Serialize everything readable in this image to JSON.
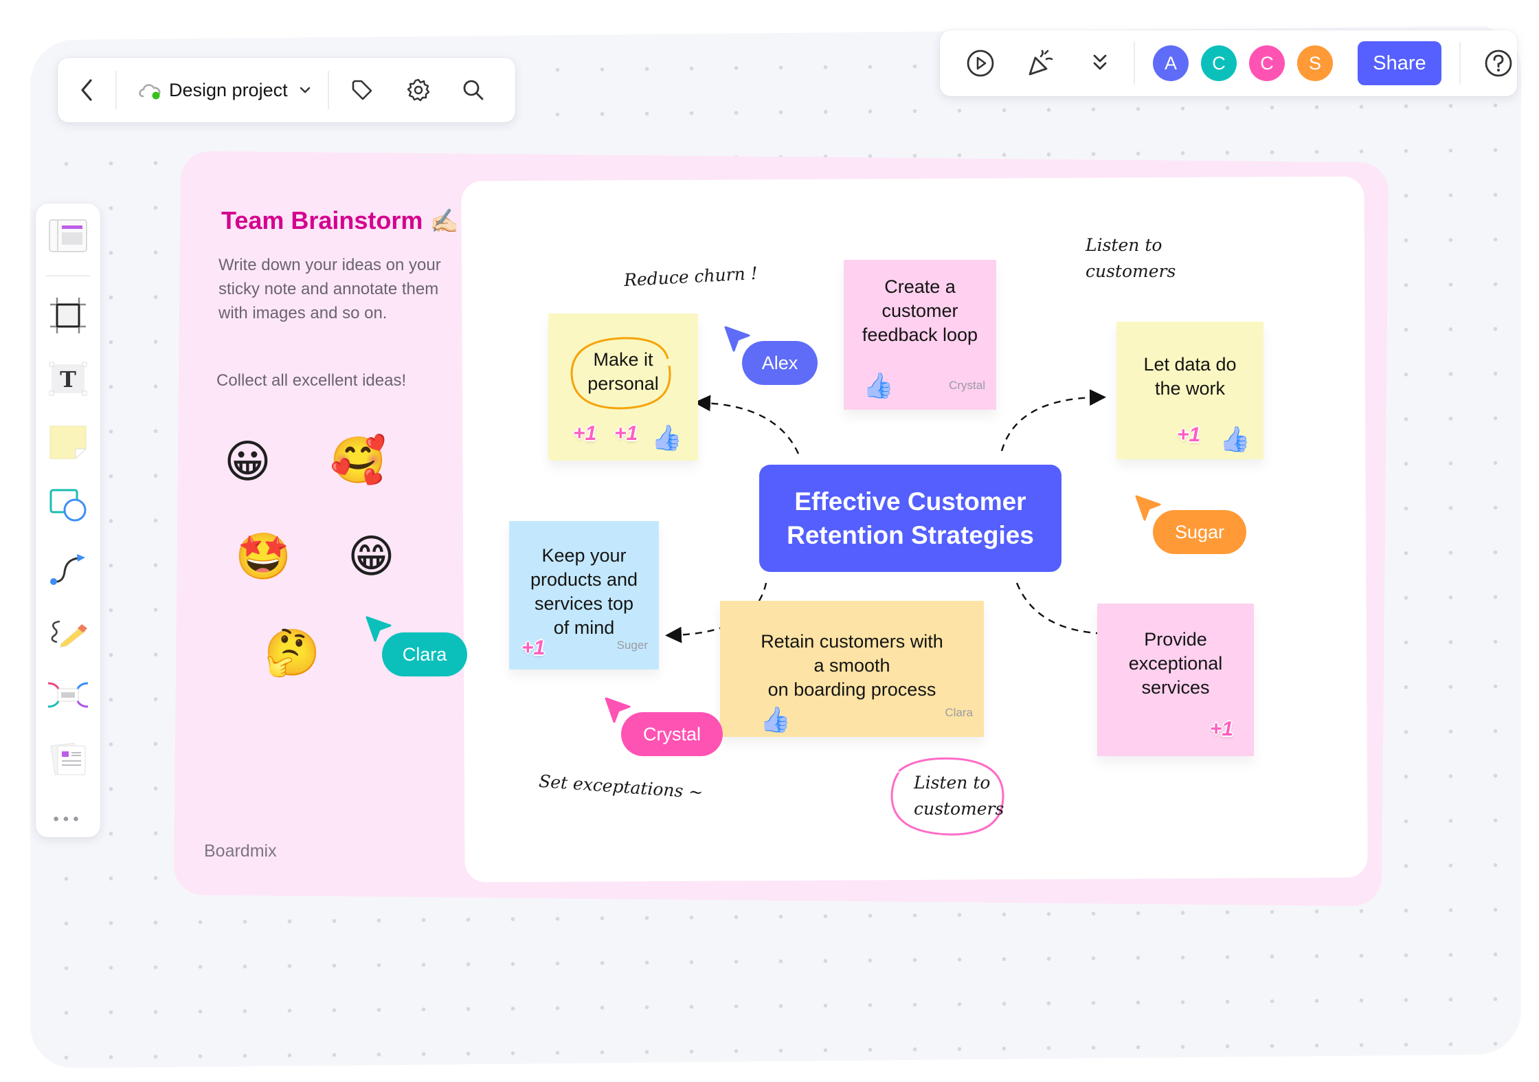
{
  "toolbar_left": {
    "back_label": "Back",
    "doc_title": "Design project",
    "sync_status": "synced",
    "icons": [
      "chevron-left-icon",
      "cloud-icon",
      "chevron-down-icon",
      "tag-icon",
      "gear-icon",
      "search-icon"
    ]
  },
  "toolbar_right": {
    "icons": [
      "play-icon",
      "celebrate-icon",
      "double-chevron-down-icon",
      "help-icon"
    ],
    "avatars": [
      {
        "initial": "A",
        "color": "#5e6cf8"
      },
      {
        "initial": "C",
        "color": "#0bc0bb"
      },
      {
        "initial": "C",
        "color": "#ff53b4"
      },
      {
        "initial": "S",
        "color": "#ff9a36"
      }
    ],
    "share_label": "Share",
    "help_label": "?"
  },
  "tool_rail": {
    "tools": [
      {
        "name": "template",
        "icon": "template-icon"
      },
      {
        "name": "frame",
        "icon": "frame-icon"
      },
      {
        "name": "text",
        "icon": "text-icon",
        "glyph": "T"
      },
      {
        "name": "sticky-note",
        "icon": "sticky-note-icon"
      },
      {
        "name": "shapes",
        "icon": "shapes-icon"
      },
      {
        "name": "connector",
        "icon": "connector-icon"
      },
      {
        "name": "pen",
        "icon": "pen-icon"
      },
      {
        "name": "mind-map",
        "icon": "mind-map-icon"
      },
      {
        "name": "more-templates",
        "icon": "document-icon"
      }
    ],
    "more_label": "•••"
  },
  "frame": {
    "title": "Team Brainstorm",
    "title_emoji": "✍🏻",
    "description": "Write down your ideas on your sticky note and annotate them with images and so on.",
    "cta": "Collect all excellent ideas!",
    "emojis": [
      "😀",
      "🥰",
      "🤩",
      "😁",
      "🤔"
    ],
    "brand": "Boardmix",
    "colors": {
      "title": "#d4008f",
      "background": "#fde6f7"
    }
  },
  "central_topic": {
    "line1": "Effective Customer",
    "line2": "Retention Strategies",
    "color": "#545ffd"
  },
  "sticky_notes": [
    {
      "id": "make-it-personal",
      "text_lines": [
        "Make it",
        "personal"
      ],
      "author": "",
      "reactions": [
        "+1",
        "+1",
        "👍"
      ],
      "color": "#fbf7c2"
    },
    {
      "id": "feedback-loop",
      "text_lines": [
        "Create a",
        "customer",
        "feedback loop"
      ],
      "author": "Crystal",
      "reactions": [
        "👍"
      ],
      "color": "#ffd0ef"
    },
    {
      "id": "let-data",
      "text_lines": [
        "Let data do",
        "the work"
      ],
      "author": "",
      "reactions": [
        "+1",
        "👍"
      ],
      "color": "#fbf7c2"
    },
    {
      "id": "keep-top-of-mind",
      "text_lines": [
        "Keep your",
        "products and",
        "services top",
        "of mind"
      ],
      "author": "Suger",
      "reactions": [
        "+1"
      ],
      "color": "#c3e8fd"
    },
    {
      "id": "onboarding",
      "text_lines": [
        "Retain customers with",
        "a smooth",
        "on boarding process"
      ],
      "author": "Clara",
      "reactions": [
        "👍"
      ],
      "color": "#fde3a5"
    },
    {
      "id": "exceptional-services",
      "text_lines": [
        "Provide",
        "exceptional",
        "services"
      ],
      "author": "",
      "reactions": [
        "+1"
      ],
      "color": "#ffd0ef"
    }
  ],
  "handwritten_notes": {
    "reduce_churn": "Reduce churn !",
    "listen_top_1": "Listen to",
    "listen_top_2": "customers",
    "set_expectations": "Set exceptations ~",
    "listen_circled_1": "Listen to",
    "listen_circled_2": "customers"
  },
  "cursors": [
    {
      "name": "Alex",
      "color": "#5e6cf8"
    },
    {
      "name": "Sugar",
      "color": "#ff9a36"
    },
    {
      "name": "Clara",
      "color": "#0bc0bb"
    },
    {
      "name": "Crystal",
      "color": "#ff53b4"
    }
  ]
}
